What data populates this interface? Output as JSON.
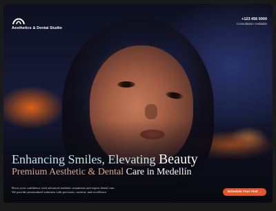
{
  "brand": {
    "name": "Aesthetics & Dental Studio",
    "icon": "smile-arc-logo-icon"
  },
  "contact": {
    "phone": "+123 456 0000",
    "availability": "Consultation Available"
  },
  "hero": {
    "title_part1": "Enhancing Smiles, ",
    "title_part2": "Elevating ",
    "title_part3": "Beauty",
    "subtitle_part1": "Premium Aesthetic & Dental ",
    "subtitle_part2": "Care in Medellín",
    "description_line1": "Boost your confidence with advanced aesthetic treatments and expert dental care.",
    "description_line2": "We provide personalized solutions with precision, comfort, and excellence."
  },
  "cta": {
    "label": "Schedule Your Visit",
    "icon": "arrow-icon"
  },
  "colors": {
    "accent": "#e2562a",
    "background": "#151a36",
    "headline_highlight": "#bfe3ea"
  }
}
